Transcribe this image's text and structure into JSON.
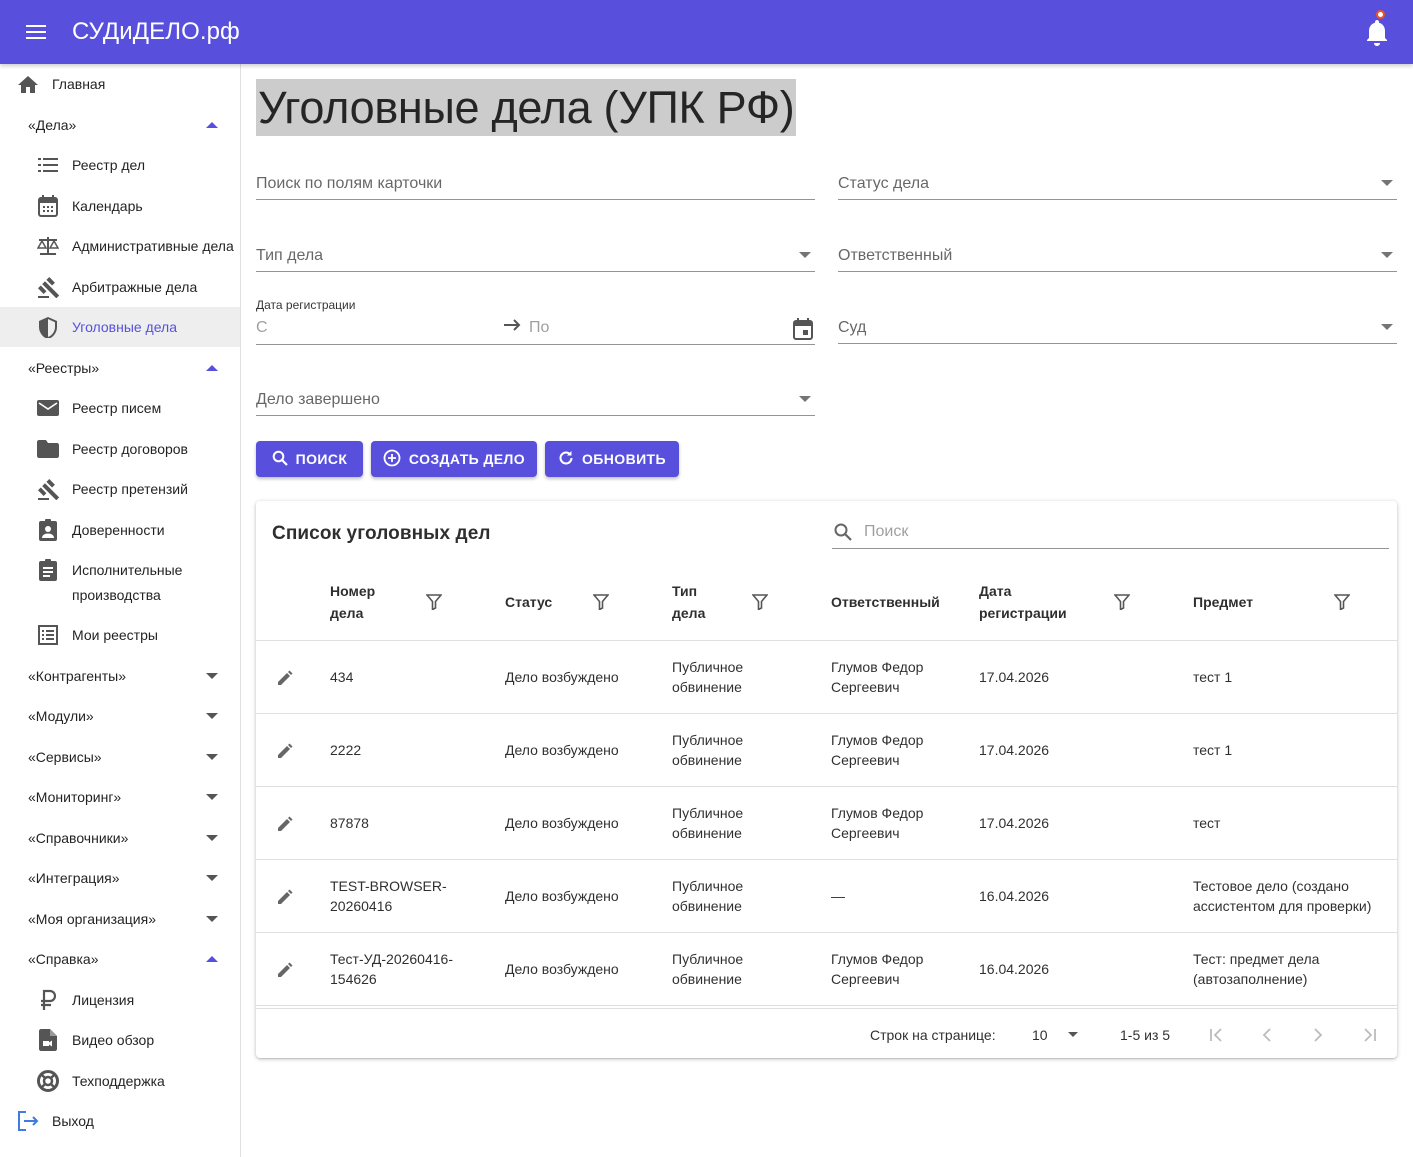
{
  "app": {
    "brand": "СУДиДЕЛО.рф"
  },
  "sidebar": {
    "home": "Главная",
    "cases_group": "«Дела»",
    "cases_items": [
      "Реестр дел",
      "Календарь",
      "Административные дела",
      "Арбитражные дела",
      "Уголовные дела"
    ],
    "registries_group": "«Реестры»",
    "registries_items": [
      "Реестр писем",
      "Реестр договоров",
      "Реестр претензий",
      "Доверенности",
      "Исполнительные",
      "производства",
      "Мои реестры"
    ],
    "groups": [
      "«Контрагенты»",
      "«Модули»",
      "«Сервисы»",
      "«Мониторинг»",
      "«Справочники»",
      "«Интеграция»",
      "«Моя организация»"
    ],
    "help_group": "«Справка»",
    "help_items": [
      "Лицензия",
      "Видео обзор",
      "Техподдержка"
    ],
    "logout": "Выход"
  },
  "page": {
    "title": "Уголовные дела (УПК РФ)"
  },
  "filters": {
    "search_placeholder": "Поиск по полям карточки",
    "status": "Статус дела",
    "type": "Тип дела",
    "responsible": "Ответственный",
    "date_label": "Дата регистрации",
    "date_from": "С",
    "date_to": "По",
    "court": "Суд",
    "completed": "Дело завершено"
  },
  "buttons": {
    "search": "Поиск",
    "create": "Создать дело",
    "refresh": "Обновить"
  },
  "table": {
    "title": "Список уголовных дел",
    "search_placeholder": "Поиск",
    "headers": {
      "number_1": "Номер",
      "number_2": "дела",
      "status": "Статус",
      "type_1": "Тип",
      "type_2": "дела",
      "responsible": "Ответственный",
      "date_1": "Дата",
      "date_2": "регистрации",
      "subject": "Предмет"
    },
    "rows": [
      {
        "n1": "434",
        "n2": "",
        "status": "Дело возбуждено",
        "t1": "Публичное",
        "t2": "обвинение",
        "r1": "Глумов Федор",
        "r2": "Сергеевич",
        "date": "17.04.2026",
        "s1": "тест 1",
        "s2": ""
      },
      {
        "n1": "2222",
        "n2": "",
        "status": "Дело возбуждено",
        "t1": "Публичное",
        "t2": "обвинение",
        "r1": "Глумов Федор",
        "r2": "Сергеевич",
        "date": "17.04.2026",
        "s1": "тест 1",
        "s2": ""
      },
      {
        "n1": "87878",
        "n2": "",
        "status": "Дело возбуждено",
        "t1": "Публичное",
        "t2": "обвинение",
        "r1": "Глумов Федор",
        "r2": "Сергеевич",
        "date": "17.04.2026",
        "s1": "тест",
        "s2": ""
      },
      {
        "n1": "TEST-BROWSER-",
        "n2": "20260416",
        "status": "Дело возбуждено",
        "t1": "Публичное",
        "t2": "обвинение",
        "r1": "—",
        "r2": "",
        "date": "16.04.2026",
        "s1": "Тестовое дело (создано",
        "s2": "ассистентом для проверки)"
      },
      {
        "n1": "Тест-УД-20260416-",
        "n2": "154626",
        "status": "Дело возбуждено",
        "t1": "Публичное",
        "t2": "обвинение",
        "r1": "Глумов Федор",
        "r2": "Сергеевич",
        "date": "16.04.2026",
        "s1": "Тест: предмет дела",
        "s2": "(автозаполнение)"
      }
    ],
    "pager": {
      "rows_label": "Строк на странице:",
      "rows_value": "10",
      "range": "1-5 из 5"
    }
  },
  "colors": {
    "primary": "#5850DC",
    "accent_dot": "#f4511e"
  }
}
